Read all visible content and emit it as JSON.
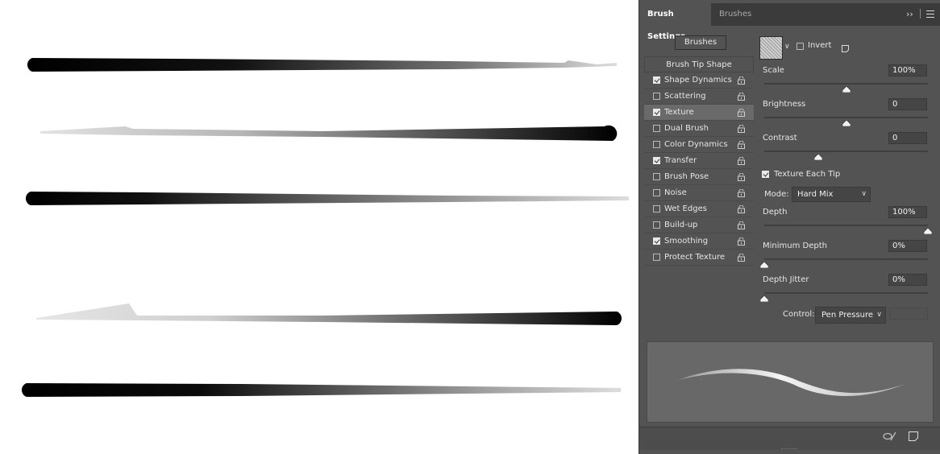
{
  "panel": {
    "tabs": [
      {
        "label": "Brush Settings",
        "active": true
      },
      {
        "label": "Brushes",
        "active": false
      }
    ],
    "collapse_icon": "double-chevron-right-icon",
    "menu_icon": "hamburger-menu-icon"
  },
  "sidebar": {
    "brushes_button": "Brushes",
    "tip_shape": "Brush Tip Shape",
    "options": [
      {
        "label": "Shape Dynamics",
        "checked": true
      },
      {
        "label": "Scattering",
        "checked": false
      },
      {
        "label": "Texture",
        "checked": true,
        "selected": true
      },
      {
        "label": "Dual Brush",
        "checked": false
      },
      {
        "label": "Color Dynamics",
        "checked": false
      },
      {
        "label": "Transfer",
        "checked": true
      },
      {
        "label": "Brush Pose",
        "checked": false
      },
      {
        "label": "Noise",
        "checked": false
      },
      {
        "label": "Wet Edges",
        "checked": false
      },
      {
        "label": "Build-up",
        "checked": false
      },
      {
        "label": "Smoothing",
        "checked": true
      },
      {
        "label": "Protect Texture",
        "checked": false
      }
    ]
  },
  "texture": {
    "invert_label": "Invert",
    "invert_checked": false,
    "scale": {
      "label": "Scale",
      "value": "100%",
      "slider_fraction": 0.5
    },
    "brightness": {
      "label": "Brightness",
      "value": "0",
      "slider_fraction": 0.5
    },
    "contrast": {
      "label": "Contrast",
      "value": "0",
      "slider_fraction": 0.33
    },
    "texture_each_tip": {
      "label": "Texture Each Tip",
      "checked": true
    },
    "mode": {
      "label": "Mode:",
      "value": "Hard Mix"
    },
    "depth": {
      "label": "Depth",
      "value": "100%",
      "slider_fraction": 1.0
    },
    "min_depth": {
      "label": "Minimum Depth",
      "value": "0%",
      "slider_fraction": 0.0
    },
    "depth_jitter": {
      "label": "Depth Jitter",
      "value": "0%",
      "slider_fraction": 0.0
    },
    "control": {
      "label": "Control:",
      "value": "Pen Pressure"
    }
  },
  "footer": {
    "toggle_icon": "proof-toggle-icon",
    "new_preset_icon": "new-brush-preset-icon"
  }
}
